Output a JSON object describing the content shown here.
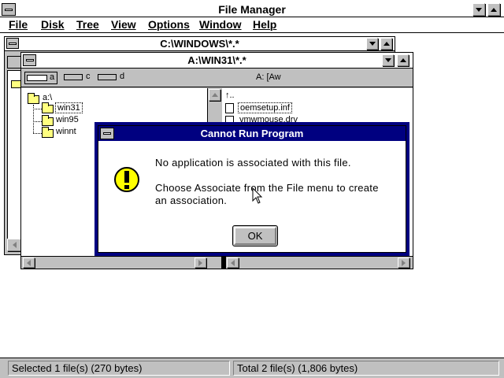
{
  "app": {
    "title": "File Manager"
  },
  "menu": {
    "items": [
      {
        "label": "File"
      },
      {
        "label": "Disk"
      },
      {
        "label": "Tree"
      },
      {
        "label": "View"
      },
      {
        "label": "Options"
      },
      {
        "label": "Window"
      },
      {
        "label": "Help"
      }
    ]
  },
  "back_window": {
    "title": "C:\\WINDOWS\\*.*"
  },
  "front_window": {
    "title": "A:\\WIN31\\*.*",
    "drives": [
      {
        "letter": "a"
      },
      {
        "letter": "c"
      },
      {
        "letter": "d"
      }
    ],
    "volume_label": "A: [Aw",
    "tree": [
      {
        "label": "a:\\"
      },
      {
        "label": "win31"
      },
      {
        "label": "win95"
      },
      {
        "label": "winnt"
      }
    ],
    "files": [
      {
        "label": "oemsetup.inf"
      },
      {
        "label": "vmwmouse.drv"
      }
    ]
  },
  "dialog": {
    "title": "Cannot Run Program",
    "message_line1": "No application is associated with this file.",
    "message_line2": "Choose Associate from the File menu to create",
    "message_line3": "an association.",
    "ok_label": "OK",
    "icon": "exclamation-icon"
  },
  "status": {
    "left": "Selected 1 file(s) (270 bytes)",
    "right": "Total 2 file(s) (1,806 bytes)"
  },
  "colors": {
    "title_active": "#000080",
    "face": "#c0c0c0",
    "folder": "#ffff80",
    "icon_yellow": "#ffff00"
  }
}
